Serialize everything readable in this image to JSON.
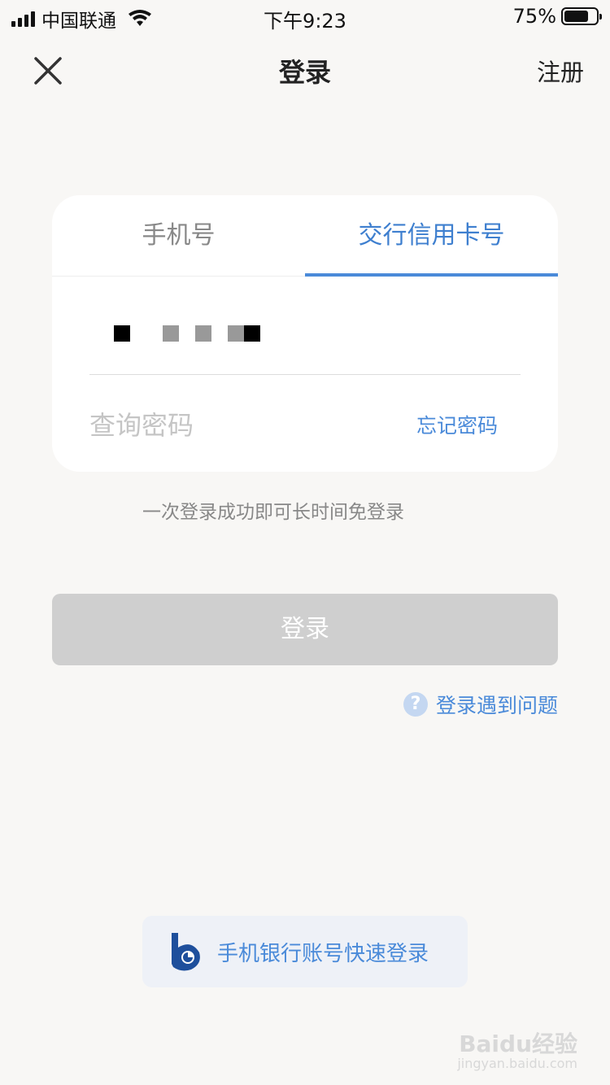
{
  "status_bar": {
    "carrier": "中国联通",
    "time": "下午9:23",
    "battery_percent": "75%",
    "battery_level": 0.75
  },
  "nav": {
    "title": "登录",
    "register": "注册",
    "close_icon": "close-icon"
  },
  "tabs": [
    {
      "label": "手机号",
      "active": false
    },
    {
      "label": "交行信用卡号",
      "active": true
    }
  ],
  "form": {
    "password_placeholder": "查询密码",
    "forgot_password": "忘记密码"
  },
  "hint": "一次登录成功即可长时间免登录",
  "login_button": "登录",
  "login_problem": "登录遇到问题",
  "quick_login": "手机银行账号快速登录",
  "watermark": {
    "main": "Baidu经验",
    "sub": "jingyan.baidu.com"
  },
  "colors": {
    "accent": "#4a8ad9",
    "disabled_button": "#cfcfcf",
    "background": "#f8f7f5"
  }
}
